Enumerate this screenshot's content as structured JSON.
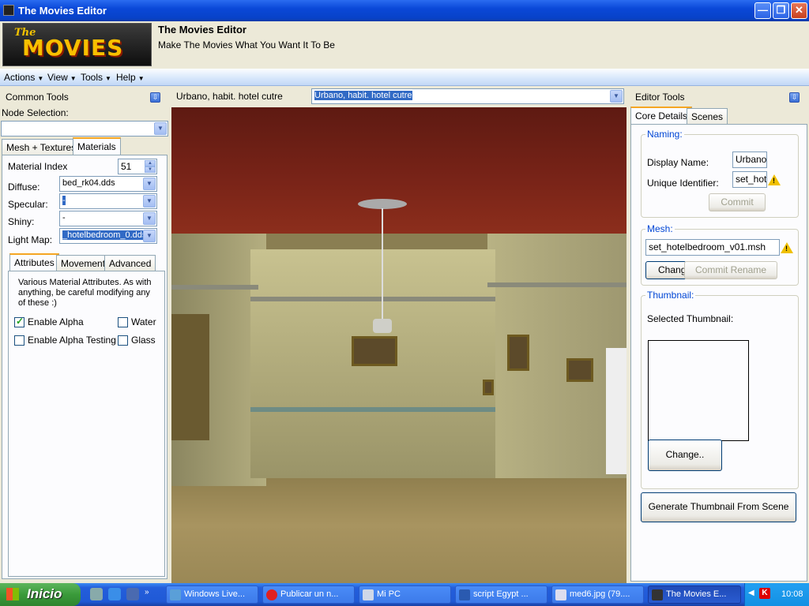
{
  "window": {
    "title": "The Movies Editor"
  },
  "header": {
    "logo_small": "The",
    "logo_big": "MOVIES",
    "app_name": "The Movies Editor",
    "tagline": "Make The Movies What You Want It To Be"
  },
  "menu": [
    "Actions",
    "View",
    "Tools",
    "Help"
  ],
  "left": {
    "title": "Common Tools",
    "node_selection_label": "Node Selection:",
    "node_selection_value": "",
    "tabs": [
      "Mesh + Textures",
      "Materials"
    ],
    "material_index_label": "Material Index",
    "material_index_value": "51",
    "diffuse_label": "Diffuse:",
    "diffuse_value": "bed_rk04.dds",
    "specular_label": "Specular:",
    "specular_value": "-",
    "shiny_label": "Shiny:",
    "shiny_value": "-",
    "lightmap_label": "Light Map:",
    "lightmap_value": "_hotelbedroom_0.dds",
    "subtabs": [
      "Attributes",
      "Movement",
      "Advanced"
    ],
    "attr_desc": "Various Material Attributes. As with anything, be careful modifying any of these :)",
    "checkboxes": [
      {
        "label": "Enable Alpha",
        "checked": true
      },
      {
        "label": "Water",
        "checked": false
      },
      {
        "label": "Enable Alpha Testing",
        "checked": false
      },
      {
        "label": "Glass",
        "checked": false
      }
    ]
  },
  "center": {
    "scene_label": "Urbano, habit. hotel cutre",
    "scene_select_value": "Urbano, habit. hotel cutre"
  },
  "right": {
    "title": "Editor Tools",
    "tabs": [
      "Core Details",
      "Scenes"
    ],
    "naming_group": "Naming:",
    "display_name_label": "Display Name:",
    "display_name_value": "Urbano,",
    "unique_id_label": "Unique Identifier:",
    "unique_id_value": "set_hote",
    "commit_label": "Commit",
    "mesh_group": "Mesh:",
    "mesh_value": "set_hotelbedroom_v01.msh",
    "change_mesh_label": "Chang",
    "commit_rename_label": "Commit Rename",
    "thumbnail_group": "Thumbnail:",
    "selected_thumbnail_label": "Selected Thumbnail:",
    "change_thumb_label": "Change..",
    "generate_label": "Generate Thumbnail  From Scene"
  },
  "taskbar": {
    "start_label": "Inicio",
    "tasks": [
      "Windows Live...",
      "Publicar un n...",
      "Mi PC",
      "script Egypt ...",
      "med6.jpg (79....",
      "The Movies E..."
    ],
    "clock": "10:08"
  },
  "colors": {
    "titlebar": "#0a48d8",
    "selection": "#316ac5",
    "group_label": "#0046d5",
    "taskbar": "#245edb",
    "start": "#3a9a3a",
    "tab_accent": "#f5a623"
  }
}
